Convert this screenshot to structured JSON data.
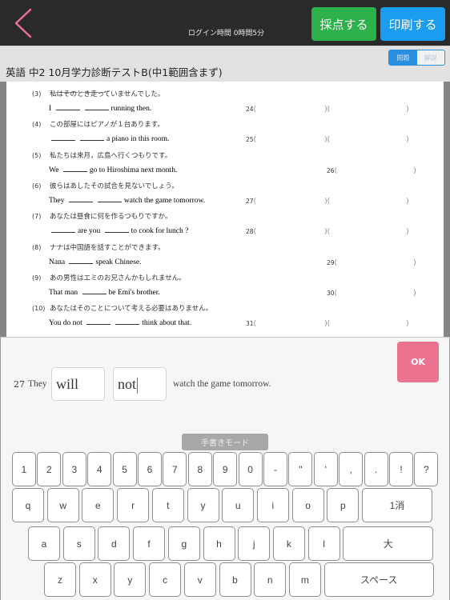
{
  "header": {
    "login_time": "ログイン時間 0時間5分",
    "score_button": "採点する",
    "print_button": "印刷する",
    "colors": {
      "score": "#2db14a",
      "print": "#1a9df0",
      "back": "#e8708f"
    }
  },
  "titlebar": {
    "title": "英語 中2 10月学力診断テストB(中1範囲含まず)",
    "toggle": {
      "problem": "問題",
      "explanation": "解説",
      "selected": "問題"
    }
  },
  "document": {
    "questions": [
      {
        "num": "(3)",
        "jp": "私はそのとき走っていませんでした。",
        "en": [
          {
            "t": "I"
          },
          {
            "b": 1
          },
          {
            "b": 1
          },
          {
            "t": "running then."
          }
        ],
        "ans_num": "24",
        "two": true
      },
      {
        "num": "(4)",
        "jp": "この部屋にはピアノが１台あります。",
        "en": [
          {
            "b": 1
          },
          {
            "b": 1
          },
          {
            "t": "a piano in this room."
          }
        ],
        "ans_num": "25",
        "two": true
      },
      {
        "num": "(5)",
        "jp": "私たちは来月，広島へ行くつもりです。",
        "en": [
          {
            "t": "We"
          },
          {
            "b": 1
          },
          {
            "t": "go to Hiroshima next month."
          }
        ],
        "ans_num": "26",
        "two": false
      },
      {
        "num": "(6)",
        "jp": "彼らはあしたその試合を見ないでしょう。",
        "en": [
          {
            "t": "They"
          },
          {
            "b": 1
          },
          {
            "b": 1
          },
          {
            "t": "watch the game tomorrow."
          }
        ],
        "ans_num": "27",
        "two": true
      },
      {
        "num": "(7)",
        "jp": "あなたは昼食に何を作るつもりですか。",
        "en": [
          {
            "b": 1
          },
          {
            "t": "are you"
          },
          {
            "b": 1
          },
          {
            "t": "to cook for lunch ?"
          }
        ],
        "ans_num": "28",
        "two": true
      },
      {
        "num": "(8)",
        "jp": "ナナは中国語を話すことができます。",
        "en": [
          {
            "t": "Nana"
          },
          {
            "b": 1
          },
          {
            "t": "speak Chinese."
          }
        ],
        "ans_num": "29",
        "two": false
      },
      {
        "num": "(9)",
        "jp": "あの男性はエミのお兄さんかもしれません。",
        "en": [
          {
            "t": "That man"
          },
          {
            "b": 1
          },
          {
            "t": "be Emi's brother."
          }
        ],
        "ans_num": "30",
        "two": false
      },
      {
        "num": "(10)",
        "jp": "あなたはそのことについて考える必要はありません。",
        "en": [
          {
            "t": "You do not"
          },
          {
            "b": 1
          },
          {
            "b": 1
          },
          {
            "t": "think about that."
          }
        ],
        "ans_num": "31",
        "two": true
      }
    ]
  },
  "answer_panel": {
    "question_number": "27",
    "prefix": "They",
    "input1_value": "will",
    "input2_value": "not",
    "suffix": "watch the game tomorrow.",
    "ok_button": "OK",
    "handwriting_mode": "手書きモード"
  },
  "keyboard": {
    "row1": [
      "1",
      "2",
      "3",
      "4",
      "5",
      "6",
      "7",
      "8",
      "9",
      "0",
      "-",
      "\"",
      "'",
      ",",
      ".",
      "!",
      "?"
    ],
    "row2": [
      "q",
      "w",
      "e",
      "r",
      "t",
      "y",
      "u",
      "i",
      "o",
      "p"
    ],
    "row2_action": "1消",
    "row3": [
      "a",
      "s",
      "d",
      "f",
      "g",
      "h",
      "j",
      "k",
      "l"
    ],
    "row3_action": "大",
    "row4": [
      "z",
      "x",
      "y",
      "c",
      "v",
      "b",
      "n",
      "m"
    ],
    "row4_action": "スペース"
  }
}
